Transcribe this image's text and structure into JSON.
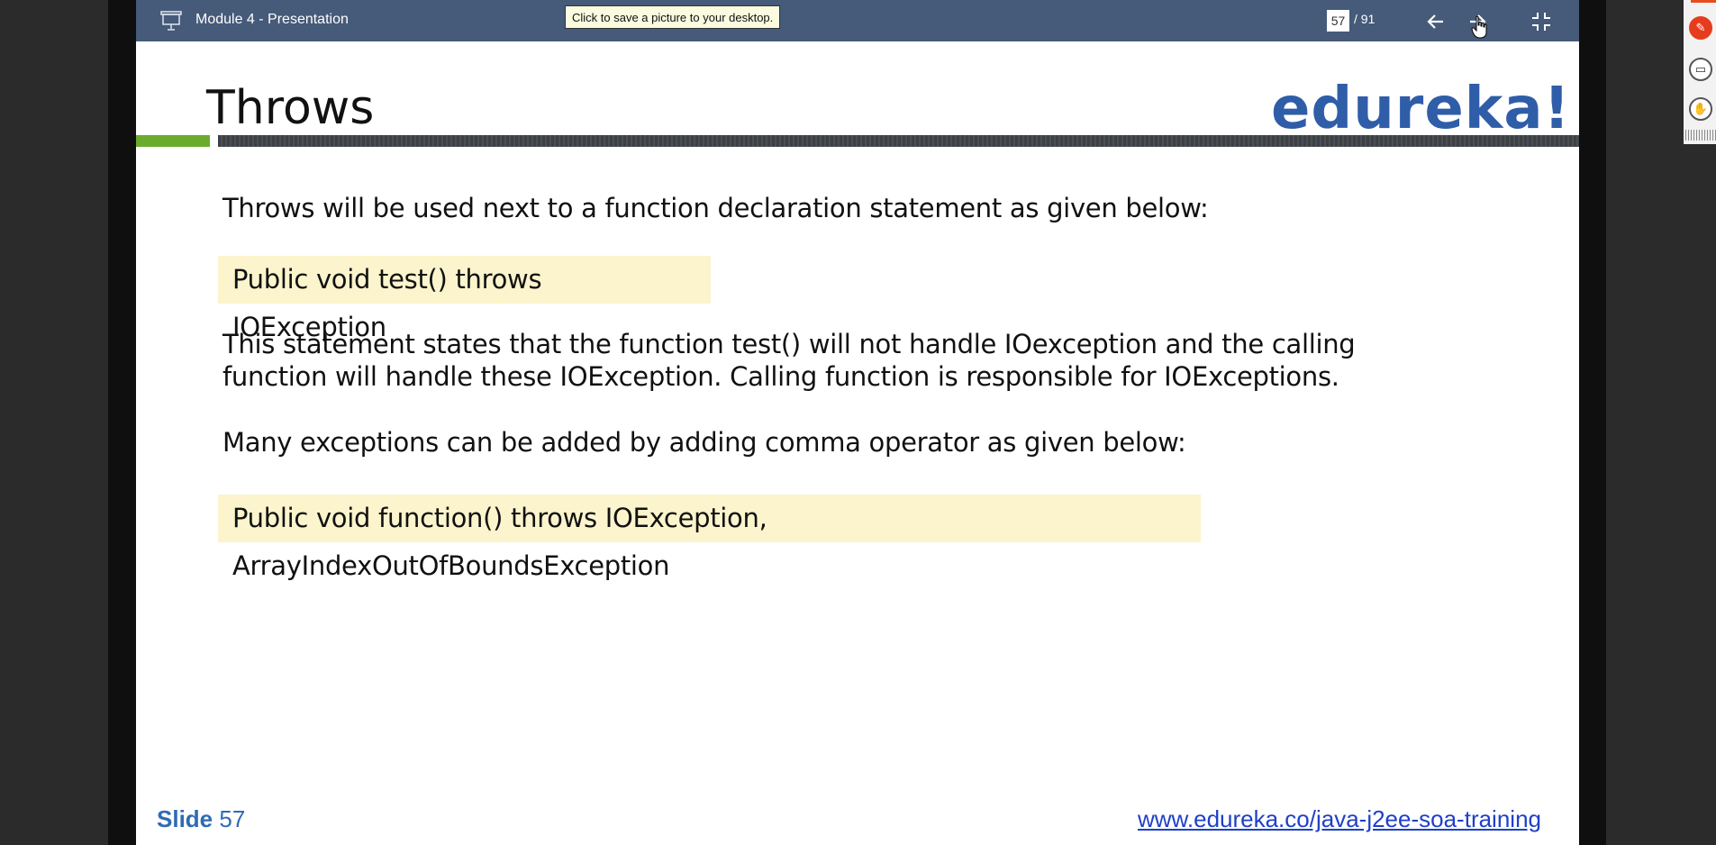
{
  "toolbar": {
    "title": "Module 4 - Presentation",
    "tooltip": "Click to save a picture to your desktop.",
    "current_page": "57",
    "total_pages": "/ 91",
    "prev_icon": "arrow-left-icon",
    "next_icon": "arrow-right-icon",
    "exit_icon": "exit-fullscreen-icon"
  },
  "slide": {
    "title": "Throws",
    "logo": "edureka!",
    "paragraph1": "Throws will be used next to a function declaration statement as given below:",
    "code1": "Public void test() throws IOException",
    "paragraph2_line1": "This statement states that the function test() will not handle IOexception and the calling",
    "paragraph2_line2": "function will handle these IOException. Calling function is responsible for IOExceptions.",
    "paragraph3": "Many exceptions can be added by adding comma operator as given below:",
    "code2": "Public void function() throws IOException, ArrayIndexOutOfBoundsException",
    "slide_label": "Slide",
    "slide_number": "57",
    "footer_link": "www.edureka.co/java-j2ee-soa-training"
  },
  "colors": {
    "toolbar_bg": "#465a79",
    "logo": "#2f5da8",
    "accent_green": "#6aab2e",
    "code_bg": "#fbf4cc",
    "link": "#1f40c8"
  }
}
